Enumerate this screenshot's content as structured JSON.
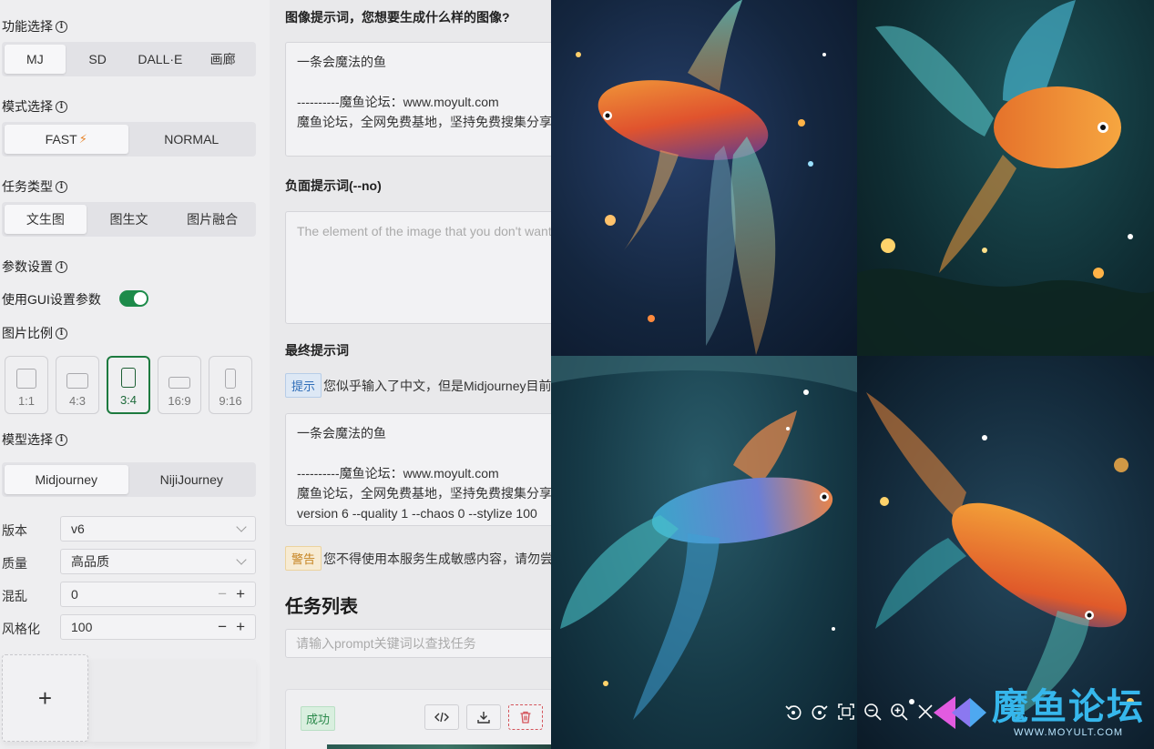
{
  "sidebar": {
    "function_label": "功能选择",
    "function_tabs": [
      "MJ",
      "SD",
      "DALL·E",
      "画廊"
    ],
    "mode_label": "模式选择",
    "mode_tabs": [
      "FAST",
      "NORMAL"
    ],
    "task_label": "任务类型",
    "task_tabs": [
      "文生图",
      "图生文",
      "图片融合"
    ],
    "param_label": "参数设置",
    "gui_label": "使用GUI设置参数",
    "gui_enabled": true,
    "ratio_label": "图片比例",
    "ratios": [
      "1:1",
      "4:3",
      "3:4",
      "16:9",
      "9:16"
    ],
    "ratio_selected": "3:4",
    "model_label": "模型选择",
    "model_tabs": [
      "Midjourney",
      "NijiJourney"
    ],
    "version_label": "版本",
    "version_value": "v6",
    "quality_label": "质量",
    "quality_value": "高品质",
    "chaos_label": "混乱",
    "chaos_value": "0",
    "stylize_label": "风格化",
    "stylize_value": "100",
    "upload_symbol": "+"
  },
  "main": {
    "prompt_title": "图像提示词，您想要生成什么样的图像?",
    "prompt_lines": [
      "一条会魔法的鱼",
      "",
      "----------魔鱼论坛：www.moyult.com",
      "魔鱼论坛，全网免费基地，坚持免费搜集分享"
    ],
    "negative_title": "负面提示词(--no)",
    "negative_placeholder": "The element of the image that you don't want",
    "final_title": "最终提示词",
    "tip_tag": "提示",
    "tip_text": "您似乎输入了中文，但是Midjourney目前",
    "final_lines": [
      "一条会魔法的鱼",
      "",
      "----------魔鱼论坛：www.moyult.com",
      "魔鱼论坛，全网免费基地，坚持免费搜集分享",
      "version 6  --quality 1  --chaos 0  --stylize 100"
    ],
    "warn_tag": "警告",
    "warn_text": "您不得使用本服务生成敏感内容，请勿尝试",
    "task_list_title": "任务列表",
    "search_placeholder": "请输入prompt关键词以查找任务",
    "task_status": "成功"
  },
  "viewer": {
    "tools": [
      "rotate-left-icon",
      "rotate-right-icon",
      "fit-screen-icon",
      "zoom-out-icon",
      "zoom-in-icon",
      "close-icon"
    ]
  },
  "watermark": {
    "name": "魔鱼论坛",
    "url": "WWW.MOYULT.COM"
  },
  "colors": {
    "accent_green": "#1d8b4a",
    "info_blue": "#2f6db8",
    "warn_orange": "#c5821f",
    "logo_blue": "#36b7ec"
  }
}
